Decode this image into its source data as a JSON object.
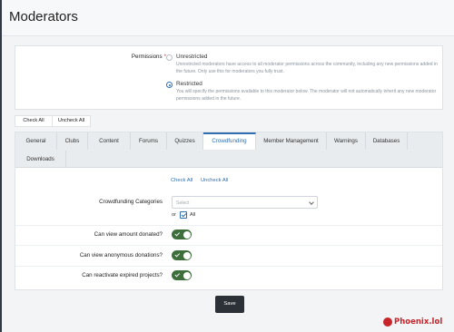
{
  "header": {
    "title": "Moderators"
  },
  "permissions": {
    "label": "Permissions",
    "required_mark": "*",
    "options": [
      {
        "title": "Unrestricted",
        "description": "Unrestricted moderators have access to all moderator permissions across the community, including any new permissions added in the future. Only use this for moderators you fully trust.",
        "selected": false
      },
      {
        "title": "Restricted",
        "description": "You will specify the permissions available to this moderator below. The moderator will not automatically inherit any new moderator permissions added in the future.",
        "selected": true
      }
    ]
  },
  "actions": {
    "check_all": "Check All",
    "uncheck_all": "Uncheck All"
  },
  "tabs": [
    {
      "label": "General"
    },
    {
      "label": "Clubs"
    },
    {
      "label": "Content"
    },
    {
      "label": "Forums"
    },
    {
      "label": "Quizzes"
    },
    {
      "label": "Crowdfunding",
      "active": true
    },
    {
      "label": "Member Management"
    },
    {
      "label": "Warnings"
    },
    {
      "label": "Databases"
    },
    {
      "label": "Downloads"
    }
  ],
  "panel": {
    "check_all": "Check All",
    "uncheck_all": "Uncheck All",
    "categories_label": "Crowdfunding Categories",
    "select_placeholder": "Select",
    "or_text": "or",
    "all_label": "All",
    "rows": [
      {
        "label": "Can view amount donated?",
        "on": true
      },
      {
        "label": "Can view anonymous donations?",
        "on": true
      },
      {
        "label": "Can reactivate expired projects?",
        "on": true
      }
    ]
  },
  "save_label": "Save",
  "watermark": "Phoenix.lol",
  "colors": {
    "accent": "#2f6fb1",
    "toggle_on": "#3e6e3c",
    "save_bg": "#2c3138"
  }
}
